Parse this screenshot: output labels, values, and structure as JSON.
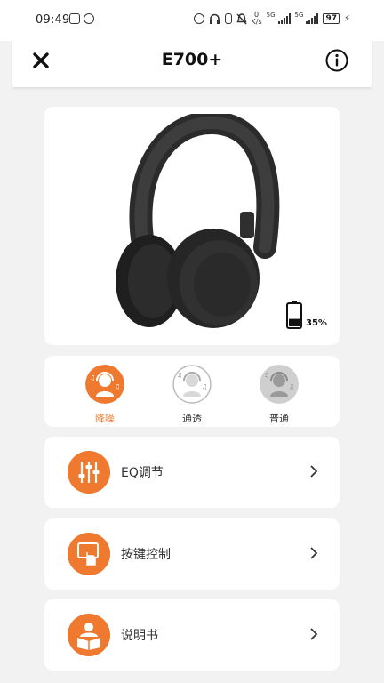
{
  "statusbar": {
    "time": "09:49",
    "speed_value": "0",
    "speed_unit": "K/s",
    "network_1": "5G",
    "network_2": "5G",
    "battery": "97"
  },
  "header": {
    "title": "E700+"
  },
  "device": {
    "battery_label": "35%",
    "battery_level": 0.35
  },
  "modes": [
    {
      "label": "降噪",
      "active": true
    },
    {
      "label": "通透",
      "active": false
    },
    {
      "label": "普通",
      "active": false
    }
  ],
  "menu": [
    {
      "label": "EQ调节",
      "icon": "equalizer-icon"
    },
    {
      "label": "按键控制",
      "icon": "touch-control-icon"
    },
    {
      "label": "说明书",
      "icon": "manual-icon"
    }
  ],
  "colors": {
    "accent": "#ef7a2f",
    "background": "#f2f2f2",
    "card": "#ffffff",
    "inactive_mode": "#cfcfcf"
  }
}
